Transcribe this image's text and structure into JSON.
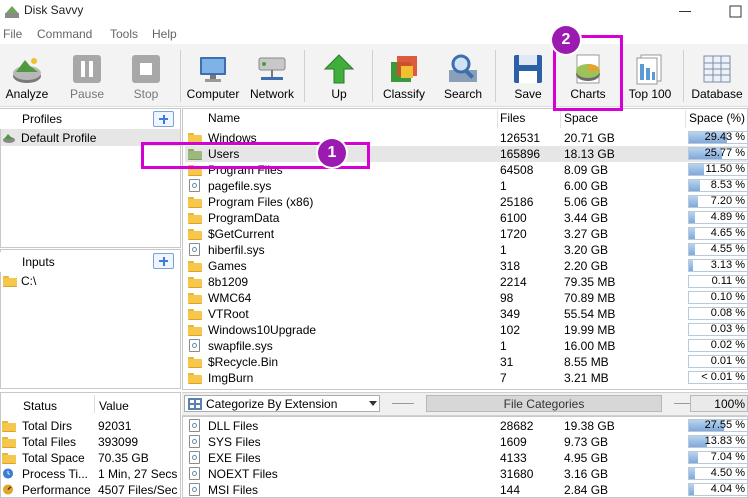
{
  "app": {
    "title": "Disk Savvy"
  },
  "menu": [
    "File",
    "Command",
    "Tools",
    "Help"
  ],
  "toolbar": {
    "analyze": "Analyze",
    "pause": "Pause",
    "stop": "Stop",
    "computer": "Computer",
    "network": "Network",
    "up": "Up",
    "classify": "Classify",
    "search": "Search",
    "save": "Save",
    "charts": "Charts",
    "top100": "Top 100",
    "database": "Database"
  },
  "profiles": {
    "header": "Profiles",
    "items": [
      "Default Profile"
    ]
  },
  "inputs": {
    "header": "Inputs",
    "items": [
      "C:\\"
    ]
  },
  "table": {
    "columns": {
      "name": "Name",
      "files": "Files",
      "space": "Space",
      "percent": "Space (%)"
    },
    "rows": [
      {
        "name": "Windows",
        "files": "126531",
        "space": "20.71 GB",
        "pct": "29.43 %",
        "fill": 29.43,
        "icon": "folder-icon"
      },
      {
        "name": "Users",
        "files": "165896",
        "space": "18.13 GB",
        "pct": "25.77 %",
        "fill": 25.77,
        "icon": "folder-icon"
      },
      {
        "name": "Program Files",
        "files": "64508",
        "space": "8.09 GB",
        "pct": "11.50 %",
        "fill": 11.5,
        "icon": "folder-icon"
      },
      {
        "name": "pagefile.sys",
        "files": "1",
        "space": "6.00 GB",
        "pct": "8.53 %",
        "fill": 8.53,
        "icon": "file-icon"
      },
      {
        "name": "Program Files (x86)",
        "files": "25186",
        "space": "5.06 GB",
        "pct": "7.20 %",
        "fill": 7.2,
        "icon": "folder-icon"
      },
      {
        "name": "ProgramData",
        "files": "6100",
        "space": "3.44 GB",
        "pct": "4.89 %",
        "fill": 4.89,
        "icon": "folder-icon"
      },
      {
        "name": "$GetCurrent",
        "files": "1720",
        "space": "3.27 GB",
        "pct": "4.65 %",
        "fill": 4.65,
        "icon": "folder-icon"
      },
      {
        "name": "hiberfil.sys",
        "files": "1",
        "space": "3.20 GB",
        "pct": "4.55 %",
        "fill": 4.55,
        "icon": "file-icon"
      },
      {
        "name": "Games",
        "files": "318",
        "space": "2.20 GB",
        "pct": "3.13 %",
        "fill": 3.13,
        "icon": "folder-icon"
      },
      {
        "name": "8b1209",
        "files": "2214",
        "space": "79.35 MB",
        "pct": "0.11 %",
        "fill": 0.11,
        "icon": "folder-icon"
      },
      {
        "name": "WMC64",
        "files": "98",
        "space": "70.89 MB",
        "pct": "0.10 %",
        "fill": 0.1,
        "icon": "folder-icon"
      },
      {
        "name": "VTRoot",
        "files": "349",
        "space": "55.54 MB",
        "pct": "0.08 %",
        "fill": 0.08,
        "icon": "folder-icon"
      },
      {
        "name": "Windows10Upgrade",
        "files": "102",
        "space": "19.99 MB",
        "pct": "0.03 %",
        "fill": 0.03,
        "icon": "folder-icon"
      },
      {
        "name": "swapfile.sys",
        "files": "1",
        "space": "16.00 MB",
        "pct": "0.02 %",
        "fill": 0.02,
        "icon": "file-icon"
      },
      {
        "name": "$Recycle.Bin",
        "files": "31",
        "space": "8.55 MB",
        "pct": "0.01 %",
        "fill": 0.01,
        "icon": "folder-icon"
      },
      {
        "name": "ImgBurn",
        "files": "7",
        "space": "3.21 MB",
        "pct": "< 0.01 %",
        "fill": 0.0,
        "icon": "folder-icon"
      }
    ]
  },
  "categorize": {
    "select": "Categorize By Extension",
    "tab": "File Categories",
    "zoom": "100%"
  },
  "categories": [
    {
      "name": "DLL Files",
      "files": "28682",
      "space": "19.38 GB",
      "pct": "27.55 %",
      "fill": 27.55
    },
    {
      "name": "SYS Files",
      "files": "1609",
      "space": "9.73 GB",
      "pct": "13.83 %",
      "fill": 13.83
    },
    {
      "name": "EXE Files",
      "files": "4133",
      "space": "4.95 GB",
      "pct": "7.04 %",
      "fill": 7.04
    },
    {
      "name": "NOEXT Files",
      "files": "31680",
      "space": "3.16 GB",
      "pct": "4.50 %",
      "fill": 4.5
    },
    {
      "name": "MSI Files",
      "files": "144",
      "space": "2.84 GB",
      "pct": "4.04 %",
      "fill": 4.04
    }
  ],
  "status": {
    "columns": {
      "key": "Status",
      "value": "Value"
    },
    "rows": [
      {
        "k": "Total Dirs",
        "v": "92031"
      },
      {
        "k": "Total Files",
        "v": "393099"
      },
      {
        "k": "Total Space",
        "v": "70.35 GB"
      },
      {
        "k": "Process Ti...",
        "v": "1 Min, 27 Secs"
      },
      {
        "k": "Performance",
        "v": "4507 Files/Sec"
      }
    ]
  },
  "annotations": {
    "badge1": "1",
    "badge2": "2"
  },
  "colors": {
    "highlight": "#d400d4",
    "badge": "#9b1bb0",
    "selected_row": "#e6e6e6",
    "bar_fill": "#7fa9d8"
  }
}
